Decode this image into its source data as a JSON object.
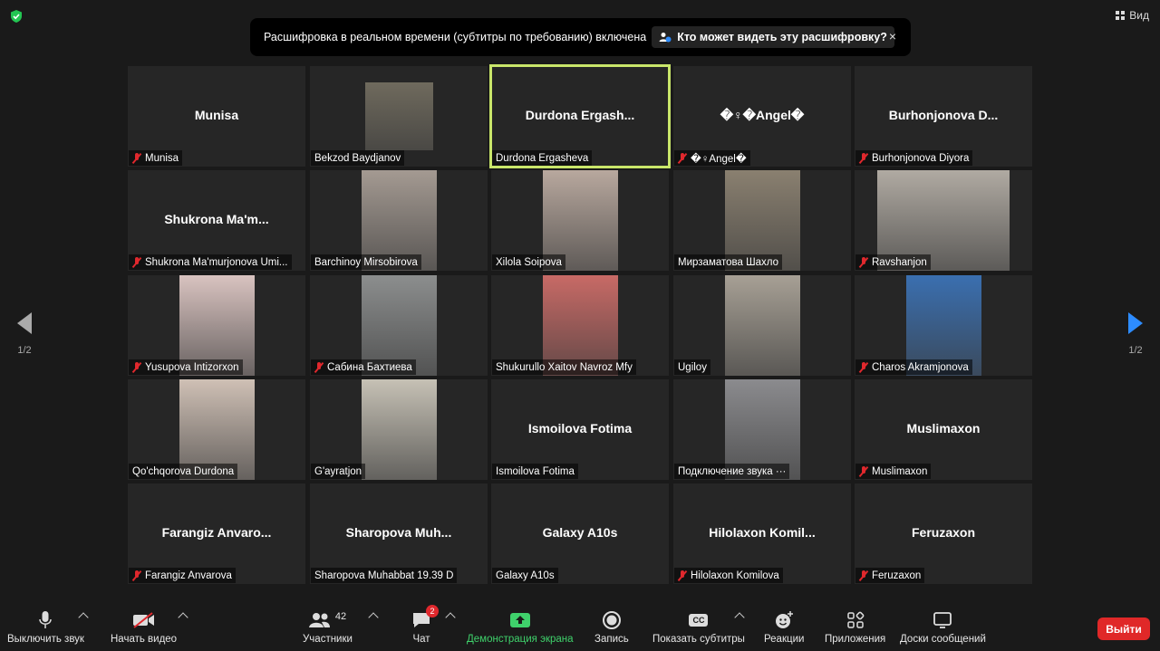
{
  "header": {
    "security_icon": "shield-check-icon",
    "view_label": "Вид"
  },
  "banner": {
    "text": "Расшифровка в реальном времени (субтитры по требованию) включена",
    "who_label": "Кто может видеть эту расшифровку?",
    "close_label": "×"
  },
  "pagination": {
    "left_page": "1/2",
    "right_page": "1/2"
  },
  "participants": [
    {
      "name": "Munisa",
      "label": "Munisa",
      "muted": true,
      "video": false
    },
    {
      "name": "",
      "label": "Bekzod Baydjanov",
      "muted": false,
      "video": true,
      "video_color": "#6f6a5d"
    },
    {
      "name": "Durdona  Ergash...",
      "label": "Durdona Ergasheva",
      "muted": false,
      "video": false,
      "active": true
    },
    {
      "name": "�♀�Angel�",
      "label": "�♀Angel�",
      "muted": true,
      "video": false
    },
    {
      "name": "Burhonjonova  D...",
      "label": "Burhonjonova Diyora",
      "muted": true,
      "video": false
    },
    {
      "name": "Shukrona  Ma'm...",
      "label": "Shukrona Ma'murjonova Umi...",
      "muted": true,
      "video": false
    },
    {
      "name": "",
      "label": "Barchinoy Mirsobirova",
      "muted": false,
      "video": true,
      "video_color": "#a49a92"
    },
    {
      "name": "",
      "label": "Xilola Soipova",
      "muted": false,
      "video": true,
      "video_color": "#b8a89e"
    },
    {
      "name": "",
      "label": "Мирзаматова Шахло",
      "muted": false,
      "video": true,
      "video_color": "#8a8070"
    },
    {
      "name": "",
      "label": "Ravshanjon",
      "muted": true,
      "video": true,
      "video_color": "#b0aaa2"
    },
    {
      "name": "",
      "label": "Yusupova Intizorxon",
      "muted": true,
      "video": true,
      "video_color": "#d9c3c0"
    },
    {
      "name": "",
      "label": "Сабина Бахтиева",
      "muted": true,
      "video": true,
      "video_color": "#8c8e8e"
    },
    {
      "name": "",
      "label": "Shukurullo Xaitov Navroz Mfy",
      "muted": false,
      "video": true,
      "video_color": "#c86a66"
    },
    {
      "name": "",
      "label": "Ugiloy",
      "muted": false,
      "video": true,
      "video_color": "#a7a095"
    },
    {
      "name": "",
      "label": "Charos Akramjonova",
      "muted": true,
      "video": true,
      "video_color": "#3a6fb0"
    },
    {
      "name": "",
      "label": "Qo'chqorova Durdona",
      "muted": false,
      "video": true,
      "video_color": "#cfc0b5"
    },
    {
      "name": "",
      "label": "G'ayratjon",
      "muted": false,
      "video": true,
      "video_color": "#c6c1b5"
    },
    {
      "name": "Ismoilova Fotima",
      "label": "Ismoilova Fotima",
      "muted": false,
      "video": false
    },
    {
      "name": "",
      "label": "Подключение звука ···",
      "muted": false,
      "video": true,
      "video_color": "#8b8b8e"
    },
    {
      "name": "Muslimaxon",
      "label": "Muslimaxon",
      "muted": true,
      "video": false
    },
    {
      "name": "Farangiz  Anvaro...",
      "label": "Farangiz Anvarova",
      "muted": true,
      "video": false
    },
    {
      "name": "Sharopova  Muh...",
      "label": "Sharopova Muhabbat 19.39 D",
      "muted": false,
      "video": false
    },
    {
      "name": "Galaxy A10s",
      "label": "Galaxy A10s",
      "muted": false,
      "video": false
    },
    {
      "name": "Hilolaxon  Komil...",
      "label": "Hilolaxon Komilova",
      "muted": true,
      "video": false
    },
    {
      "name": "Feruzaxon",
      "label": "Feruzaxon",
      "muted": true,
      "video": false
    }
  ],
  "toolbar": {
    "mute_label": "Выключить звук",
    "video_label": "Начать видео",
    "participants_label": "Участники",
    "participants_count": "42",
    "chat_label": "Чат",
    "chat_badge": "2",
    "share_label": "Демонстрация экрана",
    "record_label": "Запись",
    "captions_label": "Показать субтитры",
    "captions_icon_text": "CC",
    "reactions_label": "Реакции",
    "apps_label": "Приложения",
    "whiteboards_label": "Доски сообщений",
    "leave_label": "Выйти"
  },
  "colors": {
    "active_speaker": "#c9e66a",
    "share_green": "#3fd16b",
    "leave_red": "#e02828",
    "muted_red": "#e0282d",
    "nav_blue": "#2d8cff"
  }
}
